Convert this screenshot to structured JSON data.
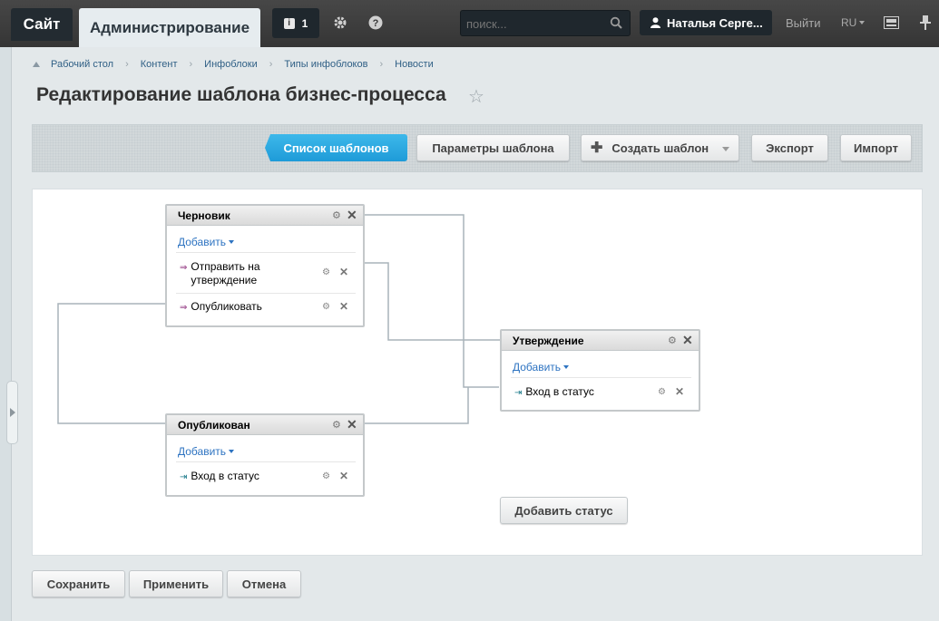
{
  "topbar": {
    "site_tab": "Сайт",
    "admin_tab": "Администрирование",
    "notifications_count": "1",
    "search_placeholder": "поиск...",
    "user_name": "Наталья Серге...",
    "logout": "Выйти",
    "lang": "RU"
  },
  "breadcrumb": [
    "Рабочий стол",
    "Контент",
    "Инфоблоки",
    "Типы инфоблоков",
    "Новости"
  ],
  "page": {
    "title": "Редактирование шаблона бизнес-процесса"
  },
  "toolbar": {
    "list": "Список шаблонов",
    "params": "Параметры шаблона",
    "create": "Создать шаблон",
    "export": "Экспорт",
    "import": "Импорт"
  },
  "states": {
    "draft": {
      "title": "Черновик",
      "add": "Добавить",
      "actions": [
        "Отправить на утверждение",
        "Опубликовать"
      ]
    },
    "approval": {
      "title": "Утверждение",
      "add": "Добавить",
      "actions": [
        "Вход в статус"
      ]
    },
    "published": {
      "title": "Опубликован",
      "add": "Добавить",
      "actions": [
        "Вход в статус"
      ]
    }
  },
  "add_status": "Добавить статус",
  "footer": {
    "save": "Сохранить",
    "apply": "Применить",
    "cancel": "Отмена"
  },
  "colors": {
    "accent_blue": "#1e9bd8",
    "link_blue": "#2d73c1",
    "connector": "#a9b3ba"
  }
}
